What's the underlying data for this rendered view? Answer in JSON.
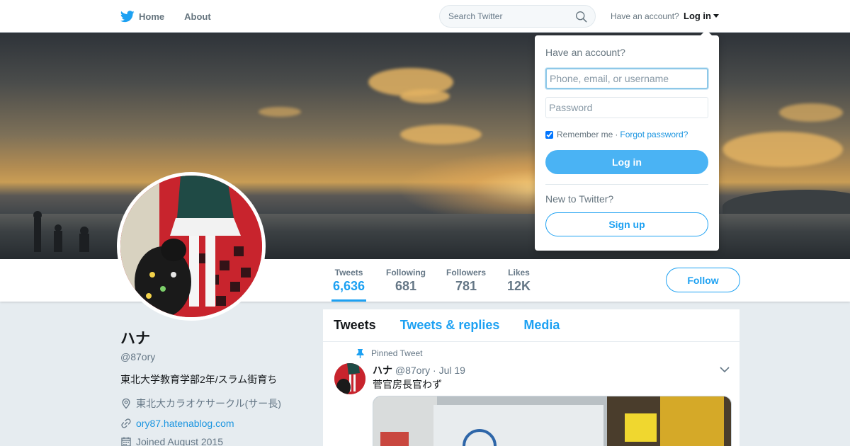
{
  "nav": {
    "home_label": "Home",
    "about_label": "About",
    "search_placeholder": "Search Twitter",
    "have_account": "Have an account?",
    "login_label": "Log in"
  },
  "login_dropdown": {
    "title": "Have an account?",
    "username_placeholder": "Phone, email, or username",
    "password_placeholder": "Password",
    "remember_label": "Remember me",
    "separator": "·",
    "forgot_label": "Forgot password?",
    "login_button": "Log in",
    "new_label": "New to Twitter?",
    "signup_button": "Sign up",
    "remember_checked": true
  },
  "stats": [
    {
      "label": "Tweets",
      "value": "6,636",
      "active": true
    },
    {
      "label": "Following",
      "value": "681"
    },
    {
      "label": "Followers",
      "value": "781"
    },
    {
      "label": "Likes",
      "value": "12K"
    }
  ],
  "follow_button": "Follow",
  "profile": {
    "name": "ハナ",
    "handle": "@87ory",
    "bio": "東北大学教育学部2年/スラム街育ち",
    "location": "東北大カラオケサークル(サー長)",
    "website": "ory87.hatenablog.com",
    "joined": "Joined August 2015"
  },
  "timeline": {
    "tabs": [
      {
        "label": "Tweets",
        "active": true
      },
      {
        "label": "Tweets & replies"
      },
      {
        "label": "Media"
      }
    ],
    "pinned_label": "Pinned Tweet",
    "tweet": {
      "name": "ハナ",
      "handle": "@87ory",
      "dot": "·",
      "date": "Jul 19",
      "text": "菅官房長官わず"
    }
  },
  "colors": {
    "brand": "#1da1f2",
    "link": "#1b95e0",
    "background": "#e6ecf0"
  }
}
